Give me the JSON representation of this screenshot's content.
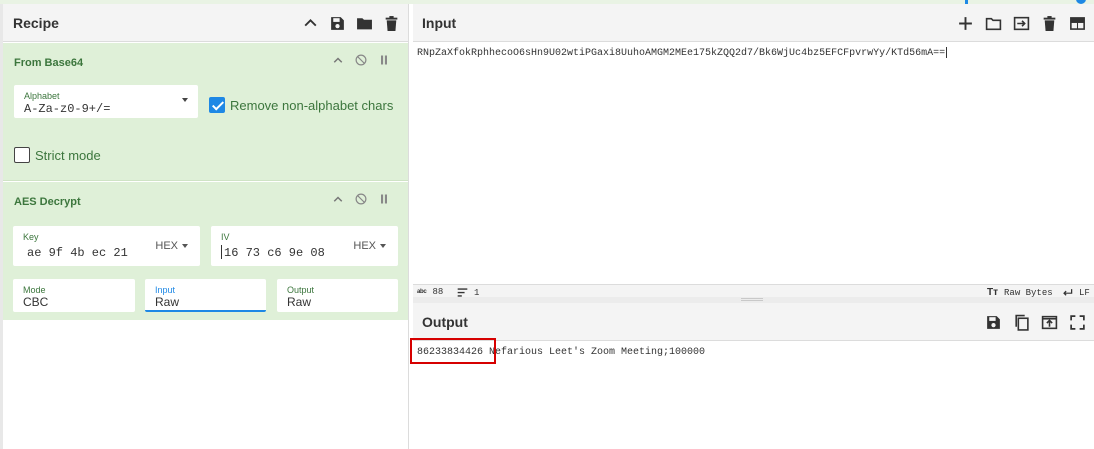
{
  "colors": {
    "accent": "#1e88e5",
    "op_bg": "#dff0d8",
    "op_text": "#3c763d",
    "highlight": "#d60000"
  },
  "recipe": {
    "title": "Recipe",
    "header_icons": [
      "chevron-up-icon",
      "save-icon",
      "folder-icon",
      "trash-icon"
    ],
    "from_base64": {
      "title": "From Base64",
      "alphabet": {
        "label": "Alphabet",
        "value": "A-Za-z0-9+/="
      },
      "remove_non_alphabet": {
        "label": "Remove non-alphabet chars",
        "checked": true
      },
      "strict_mode": {
        "label": "Strict mode",
        "checked": false
      }
    },
    "aes_decrypt": {
      "title": "AES Decrypt",
      "key": {
        "label": "Key",
        "value": "ae 9f 4b ec 21",
        "format": "HEX"
      },
      "iv": {
        "label": "IV",
        "value": "16 73 c6 9e 08",
        "format": "HEX"
      },
      "mode": {
        "label": "Mode",
        "value": "CBC"
      },
      "input": {
        "label": "Input",
        "value": "Raw"
      },
      "output": {
        "label": "Output",
        "value": "Raw"
      }
    }
  },
  "input": {
    "title": "Input",
    "header_icons": [
      "plus-icon",
      "folder-icon",
      "import-icon",
      "trash-icon",
      "layout-icon"
    ],
    "text": "RNpZaXfokRphhecoO6sHn9U02wtiPGaxi8UuhoAMGM2MEe175kZQQ2d7/Bk6WjUc4bz5EFCFpvrwYy/KTd56mA==",
    "status": {
      "length": "88",
      "lines": "1",
      "encoding": "Raw Bytes",
      "eol": "LF"
    }
  },
  "output": {
    "title": "Output",
    "header_icons": [
      "save-icon",
      "copy-icon",
      "replace-input-icon",
      "maximize-icon"
    ],
    "highlighted": "86233834426",
    "rest": " Nefarious Leet's Zoom Meeting;100000"
  }
}
